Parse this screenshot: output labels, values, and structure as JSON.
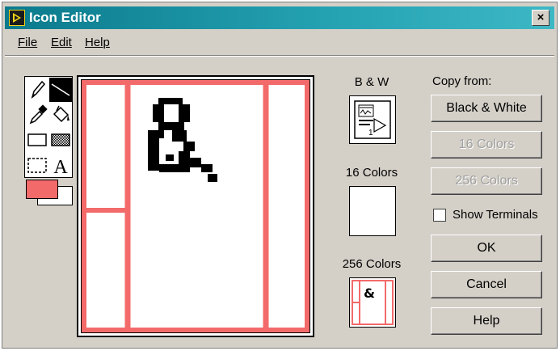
{
  "window": {
    "title": "Icon Editor",
    "close_glyph": "×"
  },
  "menu": [
    {
      "label": "File"
    },
    {
      "label": "Edit"
    },
    {
      "label": "Help"
    }
  ],
  "tools": [
    "pencil-icon",
    "line-icon",
    "dropper-icon",
    "fill-bucket-icon",
    "rectangle-icon",
    "filled-rectangle-icon",
    "select-icon",
    "text-icon"
  ],
  "colors": {
    "foreground": "#f36a6a",
    "background": "#ffffff",
    "accent": "#f36a6a"
  },
  "canvas": {
    "glyph": "&"
  },
  "previews": {
    "bw_label": "B & W",
    "c16_label": "16 Colors",
    "c256_label": "256 Colors",
    "bw_number": "1",
    "c256_glyph": "&"
  },
  "copy": {
    "label": "Copy from:",
    "black_white": "Black & White",
    "c16": "16 Colors",
    "c256": "256 Colors"
  },
  "show_terminals": {
    "label": "Show Terminals",
    "checked": false
  },
  "buttons": {
    "ok": "OK",
    "cancel": "Cancel",
    "help": "Help"
  }
}
